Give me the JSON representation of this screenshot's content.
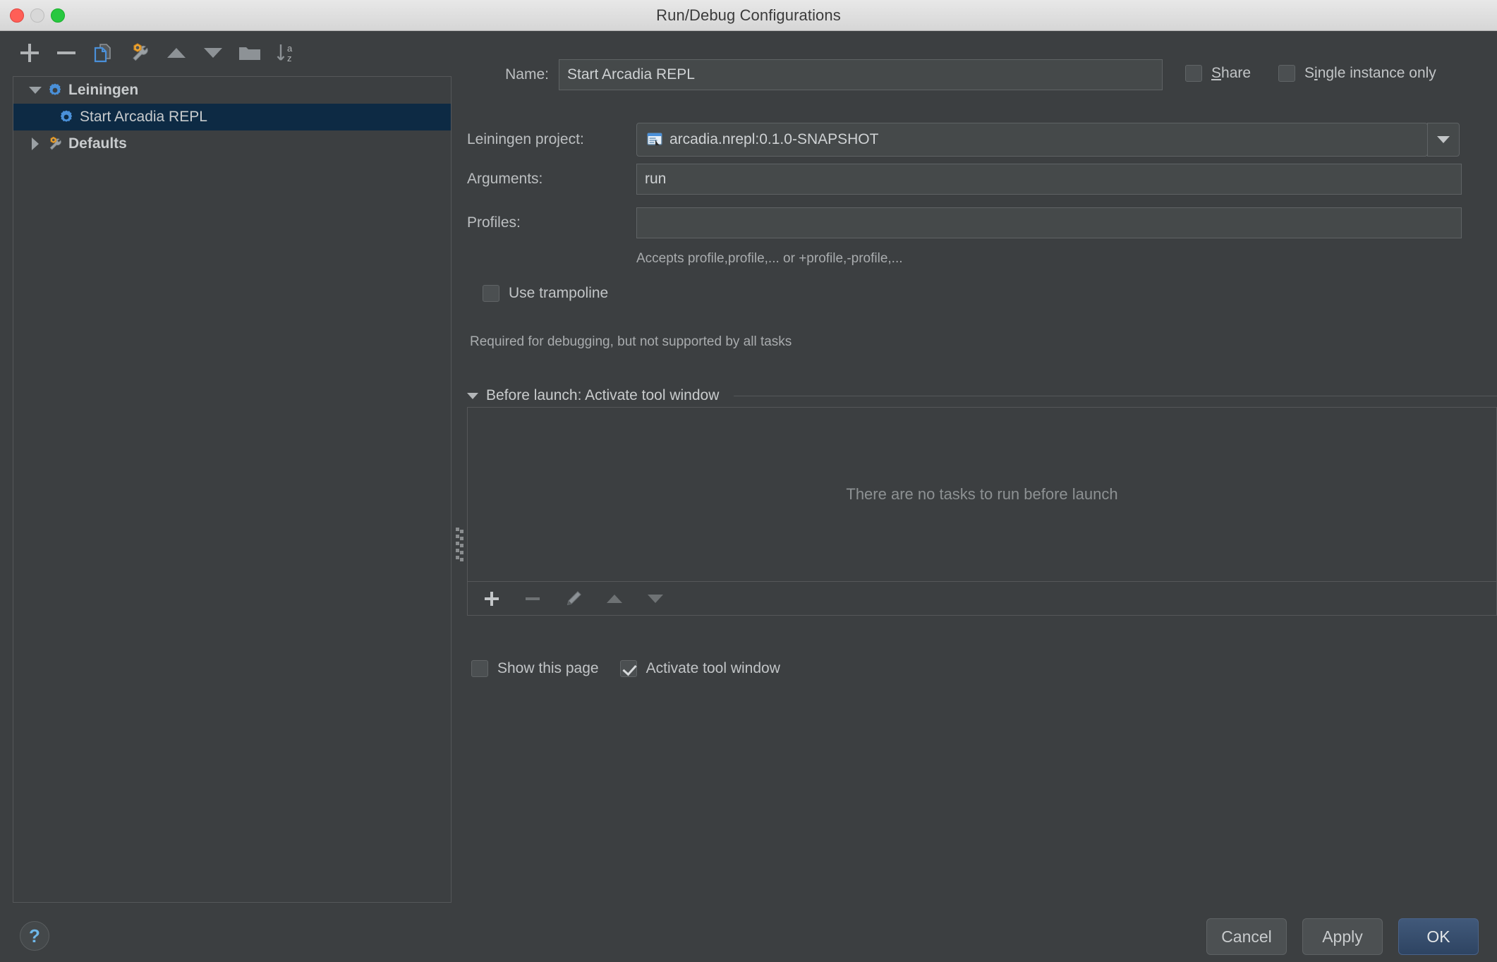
{
  "window": {
    "title": "Run/Debug Configurations",
    "traffic_lights": [
      "close-button",
      "minimize-button",
      "zoom-button"
    ]
  },
  "left_toolbar": {
    "buttons": [
      {
        "name": "add-configuration-button",
        "icon": "plus-icon"
      },
      {
        "name": "remove-configuration-button",
        "icon": "minus-icon"
      },
      {
        "name": "copy-configuration-button",
        "icon": "copy-icon"
      },
      {
        "name": "edit-defaults-button",
        "icon": "wrench-icon"
      },
      {
        "name": "move-up-button",
        "icon": "arrow-up-icon"
      },
      {
        "name": "move-down-button",
        "icon": "arrow-down-icon"
      },
      {
        "name": "create-folder-button",
        "icon": "folder-icon"
      },
      {
        "name": "sort-configurations-button",
        "icon": "sort-az-icon"
      }
    ]
  },
  "tree": {
    "nodes": [
      {
        "label": "Leiningen",
        "level": 0,
        "expanded": true,
        "selected": false,
        "icon": "gear-blue-icon",
        "bold": true
      },
      {
        "label": "Start Arcadia REPL",
        "level": 1,
        "expanded": null,
        "selected": true,
        "icon": "gear-blue-icon",
        "bold": false
      },
      {
        "label": "Defaults",
        "level": 0,
        "expanded": false,
        "selected": false,
        "icon": "wrench-icon",
        "bold": true
      }
    ]
  },
  "form": {
    "name_label": "Name:",
    "name_value": "Start Arcadia REPL",
    "share_label": "Share",
    "share_checked": false,
    "single_instance_label": "Single instance only",
    "single_instance_checked": false,
    "project_label": "Leiningen project:",
    "project_value": "arcadia.nrepl:0.1.0-SNAPSHOT",
    "project_icon": "leiningen-project-icon",
    "arguments_label": "Arguments:",
    "arguments_value": "run",
    "profiles_label": "Profiles:",
    "profiles_value": "",
    "profiles_hint": "Accepts profile,profile,... or +profile,-profile,...",
    "trampoline_label": "Use trampoline",
    "trampoline_checked": false,
    "trampoline_hint": "Required for debugging, but not supported by all tasks"
  },
  "before_launch": {
    "section_title": "Before launch: Activate tool window",
    "expanded": true,
    "empty_text": "There are no tasks to run before launch",
    "toolbar": [
      {
        "name": "add-task-button",
        "icon": "plus-icon"
      },
      {
        "name": "remove-task-button",
        "icon": "minus-icon"
      },
      {
        "name": "edit-task-button",
        "icon": "pencil-icon"
      },
      {
        "name": "move-task-up-button",
        "icon": "arrow-up-icon"
      },
      {
        "name": "move-task-down-button",
        "icon": "arrow-down-icon"
      }
    ],
    "show_page_label": "Show this page",
    "show_page_checked": false,
    "activate_window_label": "Activate tool window",
    "activate_window_checked": true
  },
  "footer": {
    "help_label": "?",
    "cancel_label": "Cancel",
    "apply_label": "Apply",
    "ok_label": "OK"
  },
  "colors": {
    "background": "#3c3f41",
    "selection": "#0d2a44",
    "accent_blue": "#4a90d9",
    "titlebar": "#dcdcdc",
    "text": "#bbbbbb"
  }
}
